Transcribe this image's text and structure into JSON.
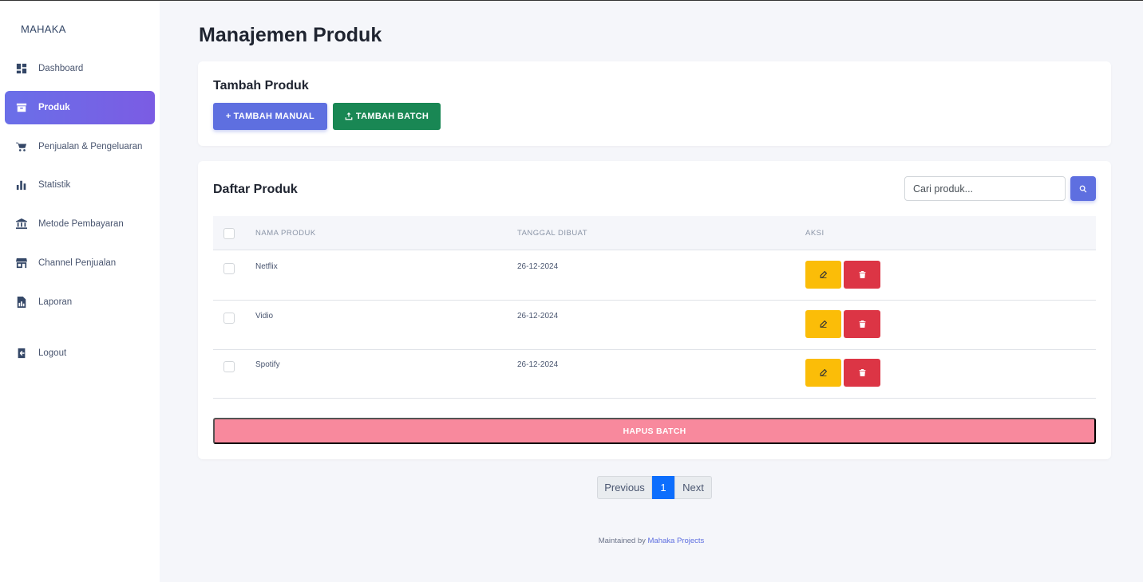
{
  "brand": "MAHAKA",
  "sidebar": {
    "items": [
      {
        "label": "Dashboard",
        "icon": "dashboard-icon"
      },
      {
        "label": "Produk",
        "icon": "archive-icon",
        "active": true
      },
      {
        "label": "Penjualan & Pengeluaran",
        "icon": "cart-icon"
      },
      {
        "label": "Statistik",
        "icon": "bar-chart-icon"
      },
      {
        "label": "Metode Pembayaran",
        "icon": "bank-icon"
      },
      {
        "label": "Channel Penjualan",
        "icon": "store-icon"
      },
      {
        "label": "Laporan",
        "icon": "report-icon"
      }
    ],
    "logout": {
      "label": "Logout",
      "icon": "logout-icon"
    }
  },
  "page_title": "Manajemen Produk",
  "add_card": {
    "title": "Tambah Produk",
    "manual_label": "TAMBAH MANUAL",
    "batch_label": "TAMBAH BATCH"
  },
  "list_card": {
    "title": "Daftar Produk",
    "search_placeholder": "Cari produk...",
    "columns": [
      "NAMA PRODUK",
      "TANGGAL DIBUAT",
      "AKSI"
    ],
    "rows": [
      {
        "name": "Netflix",
        "date": "26-12-2024"
      },
      {
        "name": "Vidio",
        "date": "26-12-2024"
      },
      {
        "name": "Spotify",
        "date": "26-12-2024"
      }
    ],
    "delete_batch_label": "HAPUS BATCH"
  },
  "pagination": {
    "prev": "Previous",
    "current": "1",
    "next": "Next"
  },
  "footer": {
    "text": "Maintained by",
    "link": "Mahaka Projects"
  },
  "colors": {
    "accent": "#5e6fe0",
    "success": "#198754",
    "warning": "#fbbd08",
    "danger": "#dc3545",
    "danger_light": "#f8899d",
    "page_active": "#0d6efd"
  }
}
